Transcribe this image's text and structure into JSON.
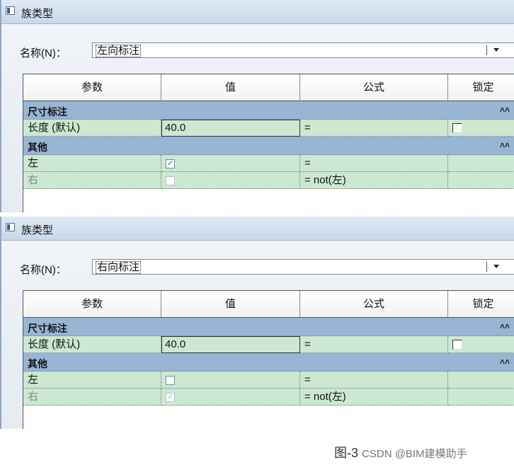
{
  "panels": [
    {
      "window_title": "族类型",
      "name_label": "名称(N)：",
      "name_value": "左向标注",
      "columns": [
        "参数",
        "值",
        "公式",
        "锁定"
      ],
      "groups": [
        {
          "label": "尺寸标注",
          "collapse_icon": "chevron-double-up-icon",
          "rows": [
            {
              "param": "长度 (默认)",
              "value": "40.0",
              "formula": "=",
              "type": "number",
              "locked": false
            }
          ]
        },
        {
          "label": "其他",
          "collapse_icon": "chevron-double-up-icon",
          "rows": [
            {
              "param": "左",
              "checked": true,
              "formula": "=",
              "type": "checkbox",
              "enabled": true
            },
            {
              "param": "右",
              "checked": false,
              "formula": "= not(左)",
              "type": "checkbox",
              "enabled": false
            }
          ]
        }
      ]
    },
    {
      "window_title": "族类型",
      "name_label": "名称(N)：",
      "name_value": "右向标注",
      "columns": [
        "参数",
        "值",
        "公式",
        "锁定"
      ],
      "groups": [
        {
          "label": "尺寸标注",
          "collapse_icon": "chevron-double-up-icon",
          "rows": [
            {
              "param": "长度 (默认)",
              "value": "40.0",
              "formula": "=",
              "type": "number",
              "locked": false
            }
          ]
        },
        {
          "label": "其他",
          "collapse_icon": "chevron-double-up-icon",
          "rows": [
            {
              "param": "左",
              "checked": false,
              "formula": "=",
              "type": "checkbox",
              "enabled": true
            },
            {
              "param": "右",
              "checked": true,
              "formula": "= not(左)",
              "type": "checkbox",
              "enabled": false
            }
          ]
        }
      ]
    }
  ],
  "caption": {
    "figure": "图-3",
    "source": "CSDN @BIM建模助手"
  },
  "colors": {
    "group_header": "#98b5d4",
    "row_bg": "#cce8d2",
    "titlebar": "#c8d8ea"
  }
}
